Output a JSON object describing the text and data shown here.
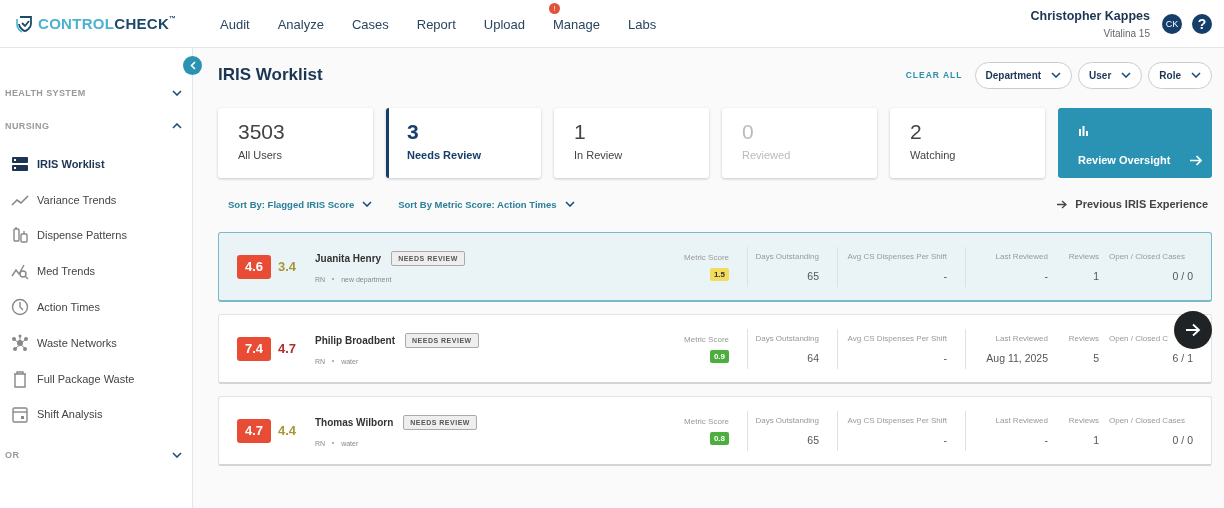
{
  "header": {
    "logo": {
      "light": "CONTROL",
      "dark": "CHECK",
      "mark": "™"
    },
    "nav": [
      {
        "label": "Audit"
      },
      {
        "label": "Analyze"
      },
      {
        "label": "Cases"
      },
      {
        "label": "Report"
      },
      {
        "label": "Upload"
      },
      {
        "label": "Manage",
        "badge": "!"
      },
      {
        "label": "Labs"
      }
    ],
    "user": {
      "name": "Christopher Kappes",
      "location": "Vitalina 15",
      "initials": "CK"
    },
    "help": "?"
  },
  "sidebar": {
    "sections": [
      {
        "label": "HEALTH SYSTEM",
        "expanded": false
      },
      {
        "label": "NURSING",
        "expanded": true,
        "items": [
          {
            "label": "IRIS Worklist",
            "selected": true
          },
          {
            "label": "Variance Trends",
            "selected": false
          },
          {
            "label": "Dispense Patterns",
            "selected": false
          },
          {
            "label": "Med Trends",
            "selected": false
          },
          {
            "label": "Action Times",
            "selected": false
          },
          {
            "label": "Waste Networks",
            "selected": false
          },
          {
            "label": "Full Package Waste",
            "selected": false
          },
          {
            "label": "Shift Analysis",
            "selected": false
          }
        ]
      },
      {
        "label": "OR",
        "expanded": false
      }
    ]
  },
  "page": {
    "title": "IRIS Worklist",
    "clear_all": "CLEAR ALL",
    "filters": [
      "Department",
      "User",
      "Role"
    ]
  },
  "stats": [
    {
      "value": "3503",
      "label": "All Users",
      "selected": false,
      "disabled": false
    },
    {
      "value": "3",
      "label": "Needs Review",
      "selected": true,
      "disabled": false
    },
    {
      "value": "1",
      "label": "In Review",
      "selected": false,
      "disabled": false
    },
    {
      "value": "0",
      "label": "Reviewed",
      "selected": false,
      "disabled": true
    },
    {
      "value": "2",
      "label": "Watching",
      "selected": false,
      "disabled": false
    }
  ],
  "oversight": {
    "label": "Review Oversight"
  },
  "sort": [
    {
      "label": "Sort By: Flagged IRIS Score"
    },
    {
      "label": "Sort By Metric Score: Action Times"
    }
  ],
  "previous_link": "Previous IRIS Experience",
  "rows": [
    {
      "score": "4.6",
      "secondary": {
        "text": "3.4",
        "color": "#a8963a"
      },
      "name": "Juanita Henry",
      "status": "NEEDS REVIEW",
      "role": "RN",
      "department": "new department",
      "selected": true,
      "metric_label": "Metric Score",
      "metric": {
        "text": "1.5",
        "color": "#f2dc5d"
      },
      "columns": [
        {
          "label": "Days Outstanding",
          "value": "65"
        },
        {
          "label": "Avg CS Dispenses Per Shift",
          "value": "-"
        },
        {
          "label": "Last Reviewed",
          "value": "-"
        },
        {
          "label": "Reviews",
          "value": "1"
        },
        {
          "label": "Open / Closed Cases",
          "value": "0 / 0"
        }
      ]
    },
    {
      "score": "7.4",
      "secondary": {
        "text": "4.7",
        "color": "#b0302a"
      },
      "name": "Philip Broadbent",
      "status": "NEEDS REVIEW",
      "role": "RN",
      "department": "water",
      "selected": false,
      "metric_label": "Metric Score",
      "metric": {
        "text": "0.9",
        "color": "#4cae3f"
      },
      "columns": [
        {
          "label": "Days Outstanding",
          "value": "64"
        },
        {
          "label": "Avg CS Dispenses Per Shift",
          "value": "-"
        },
        {
          "label": "Last Reviewed",
          "value": "Aug 11, 2025"
        },
        {
          "label": "Reviews",
          "value": "5"
        },
        {
          "label": "Open / Closed C",
          "value": "6 / 1"
        }
      ]
    },
    {
      "score": "4.7",
      "secondary": {
        "text": "4.4",
        "color": "#a8963a"
      },
      "name": "Thomas Wilborn",
      "status": "NEEDS REVIEW",
      "role": "RN",
      "department": "water",
      "selected": false,
      "metric_label": "Metric Score",
      "metric": {
        "text": "0.8",
        "color": "#4cae3f"
      },
      "columns": [
        {
          "label": "Days Outstanding",
          "value": "65"
        },
        {
          "label": "Avg CS Dispenses Per Shift",
          "value": "-"
        },
        {
          "label": "Last Reviewed",
          "value": "-"
        },
        {
          "label": "Reviews",
          "value": "1"
        },
        {
          "label": "Open / Closed Cases",
          "value": "0 / 0"
        }
      ]
    }
  ]
}
